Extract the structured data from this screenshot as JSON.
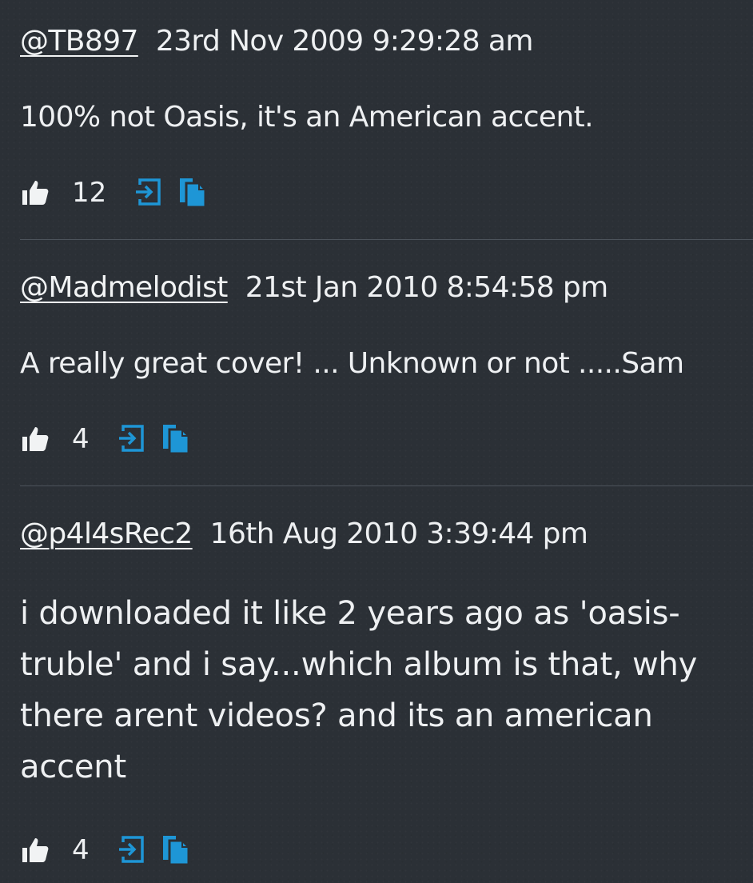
{
  "comments": [
    {
      "handle": "@TB897",
      "timestamp": "23rd Nov 2009 9:29:28 am",
      "text": "100% not Oasis, it's an American accent.",
      "likes": "12"
    },
    {
      "handle": "@Madmelodist",
      "timestamp": "21st Jan 2010 8:54:58 pm",
      "text": "A really great cover! ... Unknown or not .....Sam",
      "likes": "4"
    },
    {
      "handle": "@p4l4sRec2",
      "timestamp": "16th Aug 2010 3:39:44 pm",
      "text": "i downloaded it like 2 years ago as 'oasis-truble' and i say...which album is that, why there arent videos? and its an american accent",
      "likes": "4"
    }
  ],
  "icons": {
    "like": "thumbs-up-icon",
    "reply": "reply-arrow-icon",
    "copy": "copy-icon"
  },
  "colors": {
    "background": "#2b3036",
    "text": "#f1f3f4",
    "accent": "#1e96d6",
    "divider": "#4c535b"
  }
}
